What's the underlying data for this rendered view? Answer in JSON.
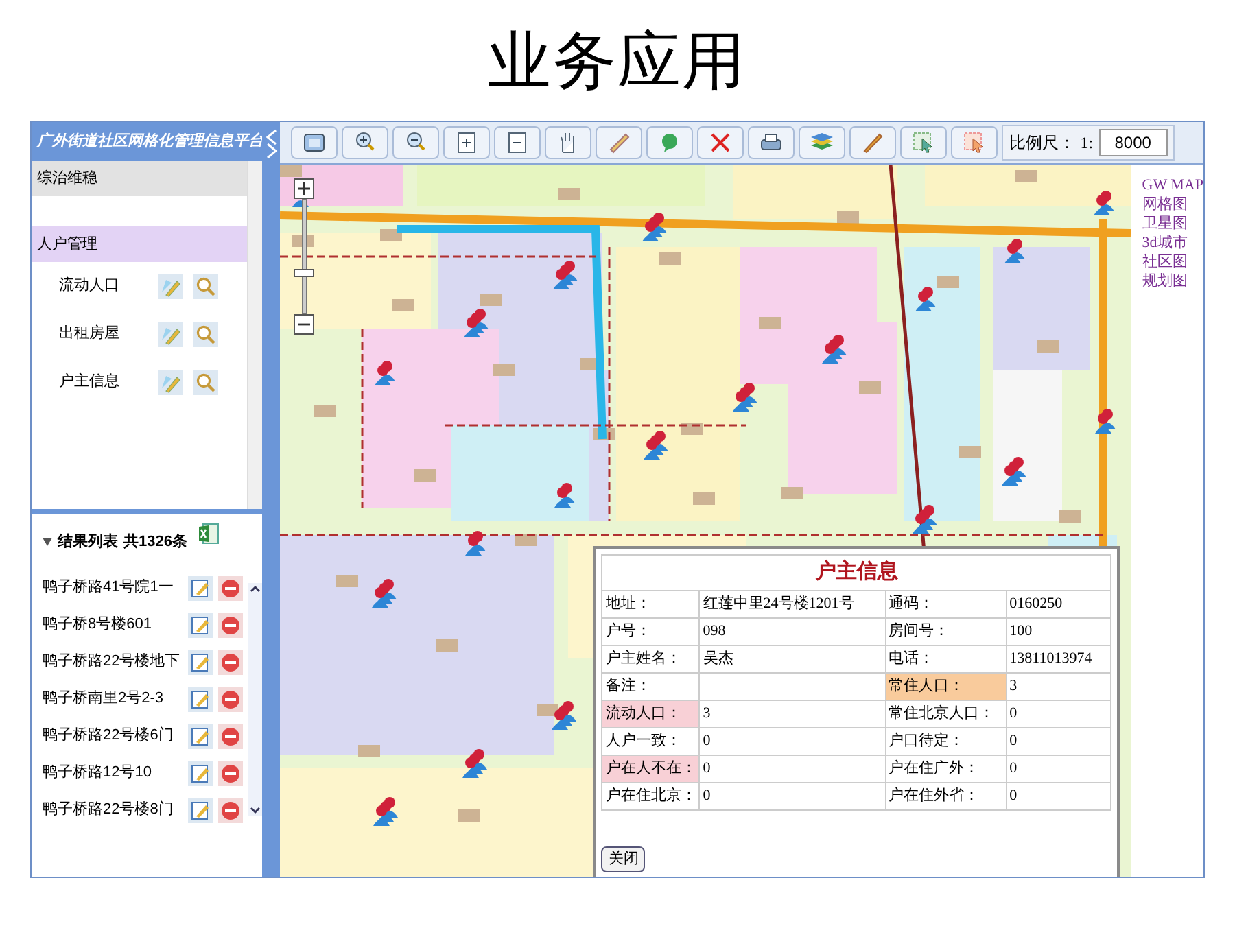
{
  "slide_title": "业务应用",
  "app_title": "广外街道社区网格化管理信息平台",
  "menu": [
    {
      "label": "综治维稳",
      "selected": false
    },
    {
      "label": "人户管理",
      "selected": true,
      "children": [
        {
          "label": "流动人口"
        },
        {
          "label": "出租房屋"
        },
        {
          "label": "户主信息"
        }
      ]
    }
  ],
  "results": {
    "title": "结果列表",
    "count": "共1326条",
    "expanded": true,
    "rows": [
      {
        "label": "鸭子桥路41号院1一"
      },
      {
        "label": "鸭子桥8号楼601"
      },
      {
        "label": "鸭子桥路22号楼地下"
      },
      {
        "label": "鸭子桥南里2号2-3"
      },
      {
        "label": "鸭子桥路22号楼6门"
      },
      {
        "label": "鸭子桥路12号10"
      },
      {
        "label": "鸭子桥路22号楼8门"
      }
    ]
  },
  "toolbar": {
    "scale_label": "比例尺：",
    "scale_prefix": "1:",
    "scale_value": "8000"
  },
  "zoom_slider": {
    "level": 0.35
  },
  "map_layers": [
    "GW MAP",
    "网格图",
    "卫星图",
    "3d城市",
    "社区图",
    "规划图"
  ],
  "popup": {
    "title": "户主信息",
    "fields": [
      {
        "label": "地址：",
        "value": "红莲中里24号楼1201号"
      },
      {
        "label": "通码：",
        "value": "0160250"
      },
      {
        "label": "户号：",
        "value": "098"
      },
      {
        "label": "房间号：",
        "value": "100"
      },
      {
        "label": "户主姓名：",
        "value": "吴杰"
      },
      {
        "label": "电话：",
        "value": "13811013974"
      },
      {
        "label": "备注："
      },
      {
        "label": "常住人口：",
        "value": "3",
        "color": "#f9cb9c"
      },
      {
        "label": "流动人口：",
        "value": "3",
        "color": "#f8d0d6"
      },
      {
        "label": "常住北京人口：",
        "value": "0"
      },
      {
        "label": "人户一致：",
        "value": "0"
      },
      {
        "label": "户口待定：",
        "value": "0"
      },
      {
        "label": "户在人不在：",
        "value": "0",
        "color": "#f8d0d6"
      },
      {
        "label": "户在住广外：",
        "value": "0"
      },
      {
        "label": "户在住北京：",
        "value": "0"
      },
      {
        "label": "户在住外省：",
        "value": "0"
      }
    ],
    "close_button": "关闭"
  }
}
